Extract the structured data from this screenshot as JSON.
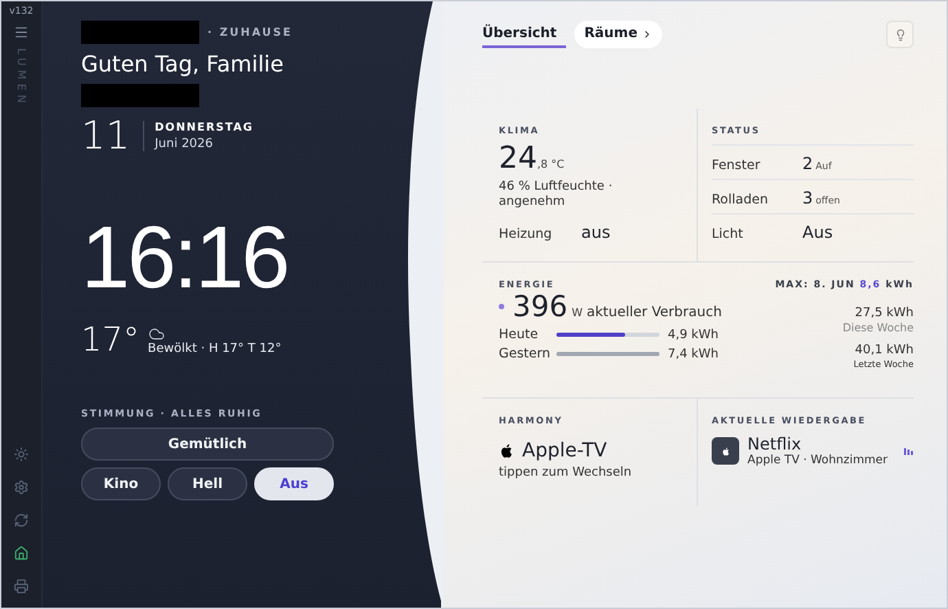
{
  "rail": {
    "version": "v132",
    "brand": "LUMEN",
    "items": [
      {
        "kind": "sun",
        "selected": false
      },
      {
        "kind": "gear",
        "selected": false
      },
      {
        "kind": "refresh",
        "selected": false
      },
      {
        "kind": "home",
        "selected": true
      },
      {
        "kind": "printer",
        "selected": false
      }
    ]
  },
  "header": {
    "location_redacted": true,
    "location_suffix": "· ZUHAUSE",
    "greeting": "Guten Tag, Familie",
    "subline_redacted": true,
    "day": "11",
    "weekday": "DONNERSTAG",
    "month": "Juni 2026"
  },
  "clock": {
    "time": "16:16"
  },
  "weather": {
    "temp": "17°",
    "summary": "Bewölkt · H 17° T 12°"
  },
  "mood": {
    "title": "STIMMUNG · ALLES RUHIG",
    "scenes": [
      {
        "label": "Gemütlich",
        "selected": false,
        "wide": true
      },
      {
        "label": "Kino",
        "selected": false,
        "wide": false
      },
      {
        "label": "Hell",
        "selected": false,
        "wide": false
      },
      {
        "label": "Aus",
        "selected": true,
        "wide": false
      }
    ]
  },
  "tabs": [
    {
      "label": "Übersicht",
      "selected": true,
      "chevron": false
    },
    {
      "label": "Räume",
      "selected": false,
      "chevron": true
    }
  ],
  "klima": {
    "title": "KLIMA",
    "temp_whole": "24",
    "temp_frac": ",8 °C",
    "humidity": "46 % Luftfeuchte · angenehm",
    "heating_label": "Heizung",
    "heating_value": "aus"
  },
  "status": {
    "title": "STATUS",
    "rows": [
      {
        "label": "Fenster",
        "value": "2",
        "unit": "Auf"
      },
      {
        "label": "Rolladen",
        "value": "3",
        "unit": "offen"
      },
      {
        "label": "Licht",
        "value": "Aus",
        "unit": ""
      }
    ]
  },
  "energie": {
    "title": "ENERGIE",
    "max_label": "MAX: 8. JUN",
    "max_value": "8,6",
    "max_unit": "kWh",
    "power": "396",
    "power_unit": "W",
    "power_label": "aktueller Verbrauch",
    "bars": [
      {
        "label": "Heute",
        "level": 0.67,
        "reading": "4,9 kWh",
        "current": true
      },
      {
        "label": "Gestern",
        "level": 1.0,
        "reading": "7,4 kWh",
        "current": false
      }
    ],
    "weeks": [
      {
        "value": "27,5 kWh",
        "label": "Diese Woche"
      },
      {
        "value": "40,1 kWh",
        "label": "Letzte Woche"
      }
    ]
  },
  "harmony": {
    "title": "HARMONY",
    "device": "Apple-TV",
    "hint": "tippen zum Wechseln"
  },
  "playback": {
    "title": "AKTUELLE WIEDERGABE",
    "app": "Netflix",
    "source": "Apple TV · Wohnzimmer",
    "playing": true
  }
}
